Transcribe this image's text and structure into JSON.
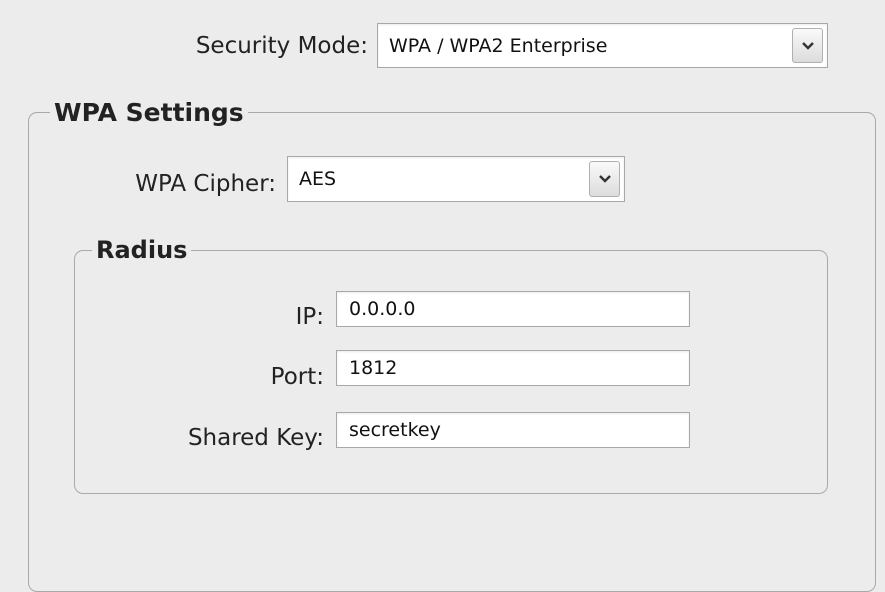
{
  "security": {
    "label": "Security Mode:",
    "value": "WPA / WPA2 Enterprise",
    "arrow_icon": "chevron-down-icon"
  },
  "wpa_settings": {
    "legend": "WPA Settings",
    "cipher": {
      "label": "WPA Cipher:",
      "value": "AES",
      "arrow_icon": "chevron-down-icon"
    }
  },
  "radius": {
    "legend": "Radius",
    "ip": {
      "label": "IP:",
      "value": "0.0.0.0"
    },
    "port": {
      "label": "Port:",
      "value": "1812"
    },
    "shared_key": {
      "label": "Shared Key:",
      "value": "secretkey"
    }
  }
}
